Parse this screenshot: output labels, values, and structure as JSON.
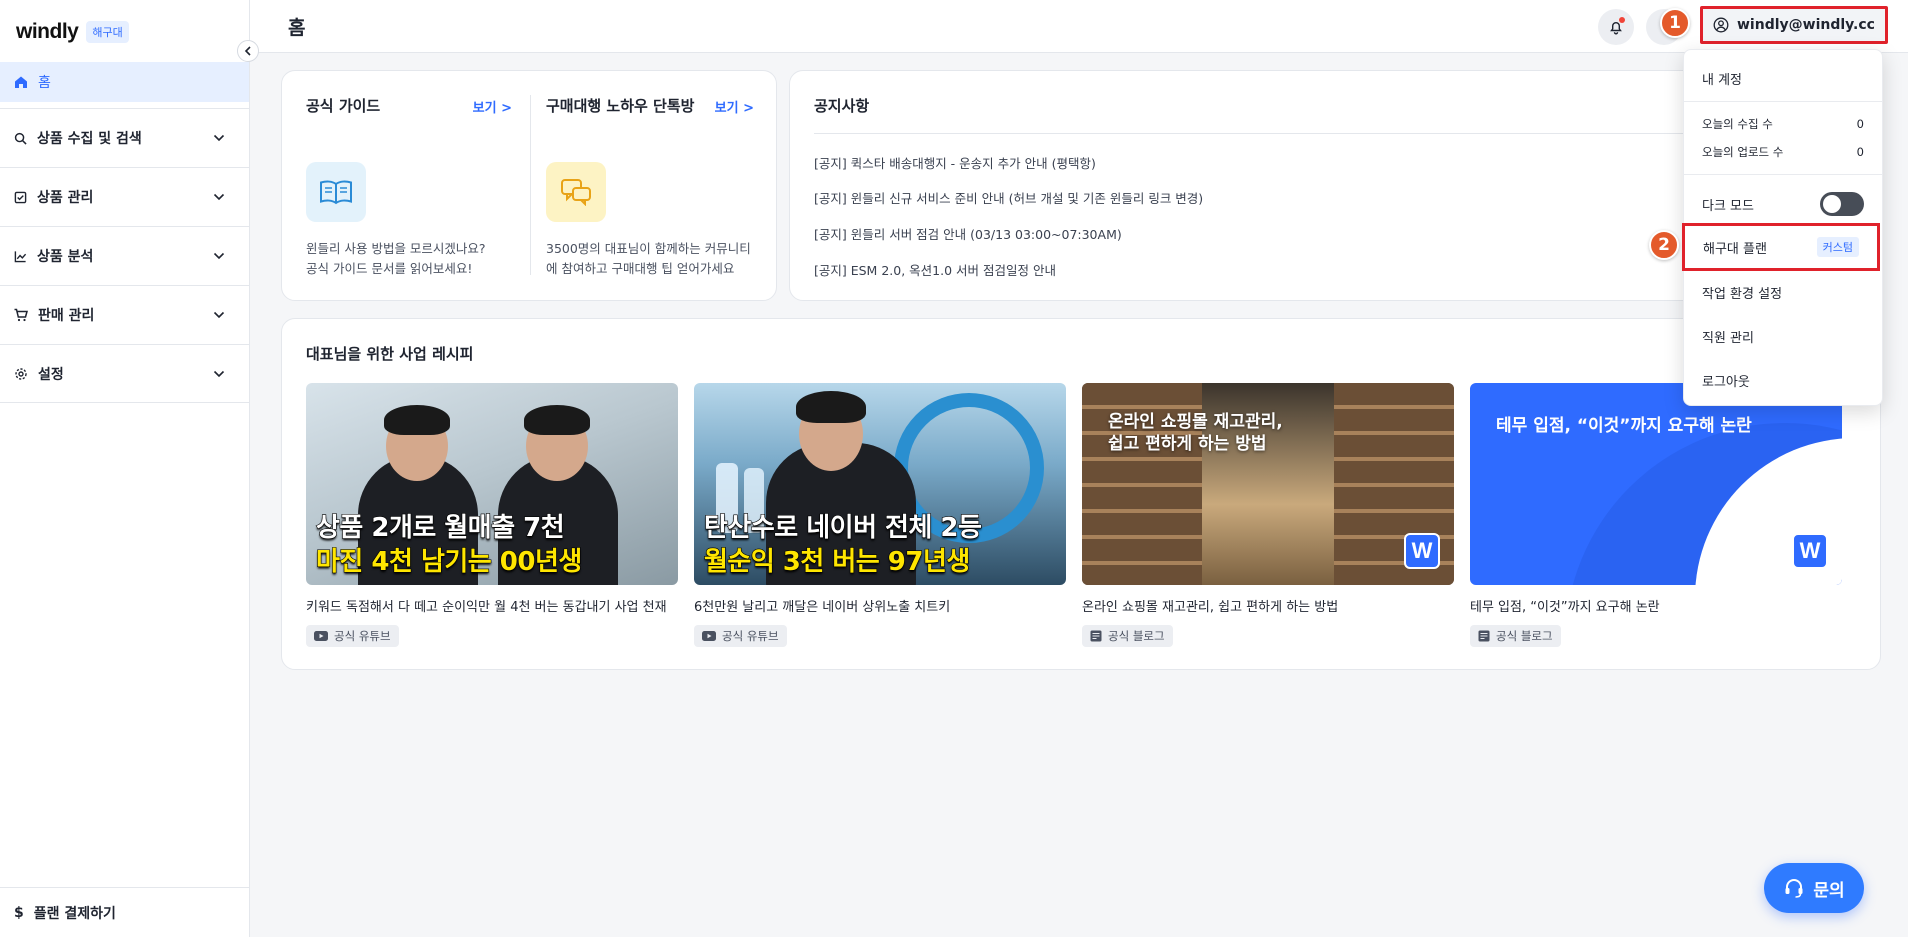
{
  "brand": {
    "name": "windly",
    "badge": "해구대"
  },
  "sidebar": {
    "home": "홈",
    "items": [
      {
        "label": "상품 수집 및 검색",
        "icon": "search-icon"
      },
      {
        "label": "상품 관리",
        "icon": "checklist-icon"
      },
      {
        "label": "상품 분석",
        "icon": "chart-icon"
      },
      {
        "label": "판매 관리",
        "icon": "cart-icon"
      },
      {
        "label": "설정",
        "icon": "gear-icon"
      }
    ],
    "bottom": "플랜 결제하기"
  },
  "header": {
    "title": "홈",
    "account": "windly@windly.cc"
  },
  "guides": [
    {
      "title": "공식 가이드",
      "link": "보기 >",
      "desc": "윈들리 사용 방법을 모르시겠나요?\n공식 가이드 문서를 읽어보세요!",
      "icon": "book-icon",
      "icon_bg": "#e3f2fb"
    },
    {
      "title": "구매대행 노하우 단톡방",
      "link": "보기 >",
      "desc": "3500명의 대표님이 함께하는 커뮤니티에 참여하고 구매대행 팁 얻어가세요",
      "icon": "chat-icon",
      "icon_bg": "#fdf3c4"
    }
  ],
  "notice": {
    "title": "공지사항",
    "items": [
      "[공지] 퀵스타 배송대행지 - 운송지 추가 안내 (평택항)",
      "[공지] 윈들리 신규 서비스 준비 안내 (허브 개설 및 기존 윈들리 링크 변경)",
      "[공지] 윈들리 서버 점검 안내 (03/13 03:00~07:30AM)",
      "[공지] ESM 2.0, 옥션1.0 서버 점검일정 안내"
    ]
  },
  "recipes": {
    "title": "대표님을 위한 사업 레시피",
    "items": [
      {
        "caption": "키워드 독점해서 다 떼고 순이익만 월 4천 버는 동갑내기 사업 천재",
        "tag": "공식 유튜브",
        "tag_icon": "youtube-icon",
        "thumb_line1": "상품 2개로 월매출 7천",
        "thumb_line2": "마진 4천 남기는 00년생"
      },
      {
        "caption": "6천만원 날리고 깨달은 네이버 상위노출 치트키",
        "tag": "공식 유튜브",
        "tag_icon": "youtube-icon",
        "thumb_line1": "탄산수로 네이버 전체 2등",
        "thumb_line2": "월순익 3천 버는 97년생"
      },
      {
        "caption": "온라인 쇼핑몰 재고관리, 쉽고 편하게 하는 방법",
        "tag": "공식 블로그",
        "tag_icon": "blog-icon",
        "thumb_text": "온라인 쇼핑몰 재고관리,\n쉽고 편하게 하는 방법",
        "logo": "W"
      },
      {
        "caption": "테무 입점, “이것”까지 요구해 논란",
        "tag": "공식 블로그",
        "tag_icon": "blog-icon",
        "thumb_text": "테무 입점, “이것”까지 요구해 논란",
        "logo": "W"
      }
    ]
  },
  "menu": {
    "account": "내 계정",
    "today_collect_label": "오늘의 수집 수",
    "today_collect_value": "0",
    "today_upload_label": "오늘의 업로드 수",
    "today_upload_value": "0",
    "dark_mode": "다크 모드",
    "plan": "해구대 플랜",
    "plan_badge": "커스텀",
    "workspace": "작업 환경 설정",
    "staff": "직원 관리",
    "logout": "로그아웃"
  },
  "annotations": {
    "step1": "1",
    "step2": "2"
  },
  "help": {
    "label": "문의"
  },
  "colors": {
    "accent": "#2f6bff",
    "highlight": "#e0222b",
    "step_badge": "#e45a2b"
  }
}
